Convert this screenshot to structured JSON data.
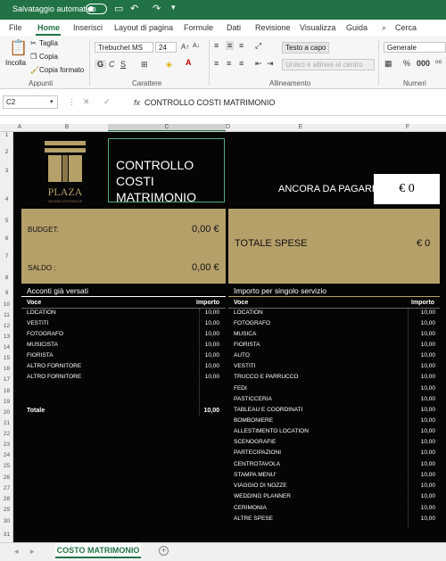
{
  "titlebar": {
    "autosave_label": "Salvataggio automatico"
  },
  "tabs": [
    "File",
    "Home",
    "Inserisci",
    "Layout di pagina",
    "Formule",
    "Dati",
    "Revisione",
    "Visualizza",
    "Guida",
    "Cerca"
  ],
  "ribbon": {
    "paste": "Incolla",
    "cut": "Taglia",
    "copy": "Copia",
    "format_painter": "Copia formato",
    "font_name": "Trebuchet MS",
    "font_size": "24",
    "wrap_text": "Testo a capo",
    "merge_center": "Unisci e allinea al centro",
    "number_format": "Generale",
    "groups": {
      "clipboard": "Appunti",
      "font": "Carattere",
      "alignment": "Allineamento",
      "number": "Numeri"
    }
  },
  "formula_bar": {
    "cell_ref": "C2",
    "fx": "fx",
    "content": "CONTROLLO COSTI MATRIMONIO"
  },
  "columns": [
    "A",
    "B",
    "C",
    "D",
    "E",
    "F"
  ],
  "rows": [
    "1",
    "2",
    "3",
    "4",
    "5",
    "6",
    "7",
    "8",
    "9",
    "10",
    "11",
    "12",
    "13",
    "14",
    "15",
    "16",
    "17",
    "18",
    "19",
    "20",
    "21",
    "22",
    "23",
    "24",
    "25",
    "26",
    "27",
    "28",
    "29",
    "30",
    "31"
  ],
  "sheet": {
    "logo_text": "PLAZA",
    "logo_sub": "WEDDING EXPERIENCE",
    "title_line1": "CONTROLLO COSTI",
    "title_line2": "MATRIMONIO",
    "ancora_label": "ANCORA DA PAGARE",
    "ancora_value": "€ 0",
    "budget_label": "BUDGET:",
    "budget_value": "0,00 €",
    "saldo_label": "SALDO :",
    "saldo_value": "0,00 €",
    "totale_label": "TOTALE SPESE",
    "totale_value": "€ 0",
    "left_section": "Acconti già versati",
    "right_section": "Importo per singolo servizio",
    "voce_header": "Voce",
    "importo_header": "Importo",
    "accent_color": "#b6a06a",
    "left_items": [
      {
        "voce": "LOCATION",
        "importo": "10,00"
      },
      {
        "voce": "VESTITI",
        "importo": "10,00"
      },
      {
        "voce": "FOTOGRAFO",
        "importo": "10,00"
      },
      {
        "voce": "MUSICISTA",
        "importo": "10,00"
      },
      {
        "voce": "FIORISTA",
        "importo": "10,00"
      },
      {
        "voce": "ALTRO FORNITORE",
        "importo": "10,00"
      },
      {
        "voce": "ALTRO FORNITORE",
        "importo": "10,00"
      }
    ],
    "left_total_label": "Totale",
    "left_total_value": "10,00",
    "right_items": [
      {
        "voce": "LOCATION",
        "importo": "10,00"
      },
      {
        "voce": "FOTOGRAFO",
        "importo": "10,00"
      },
      {
        "voce": "MUSICA",
        "importo": "10,00"
      },
      {
        "voce": "FIORISTA",
        "importo": "10,00"
      },
      {
        "voce": "AUTO",
        "importo": "10,00"
      },
      {
        "voce": "VESTITI",
        "importo": "10,00"
      },
      {
        "voce": "TRUCCO E PARRUCCO",
        "importo": "10,00"
      },
      {
        "voce": "FEDI",
        "importo": "10,00"
      },
      {
        "voce": "PASTICCERIA",
        "importo": "10,00"
      },
      {
        "voce": "TABLEAU E COORDINATI",
        "importo": "10,00"
      },
      {
        "voce": "BOMBONIERE",
        "importo": "10,00"
      },
      {
        "voce": "ALLESTIMENTO LOCATION",
        "importo": "10,00"
      },
      {
        "voce": "SCENOGRAFIE",
        "importo": "10,00"
      },
      {
        "voce": "PARTECIPAZIONI",
        "importo": "10,00"
      },
      {
        "voce": "CENTROTAVOLA",
        "importo": "10,00"
      },
      {
        "voce": "STAMPA MENU'",
        "importo": "10,00"
      },
      {
        "voce": "VIAGGIO DI NOZZE",
        "importo": "10,00"
      },
      {
        "voce": "WEDDING PLANNER",
        "importo": "10,00"
      },
      {
        "voce": "CERIMONIA",
        "importo": "10,00"
      },
      {
        "voce": "ALTRE SPESE",
        "importo": "10,00"
      }
    ]
  },
  "sheet_tab": "COSTO MATRIMONIO"
}
